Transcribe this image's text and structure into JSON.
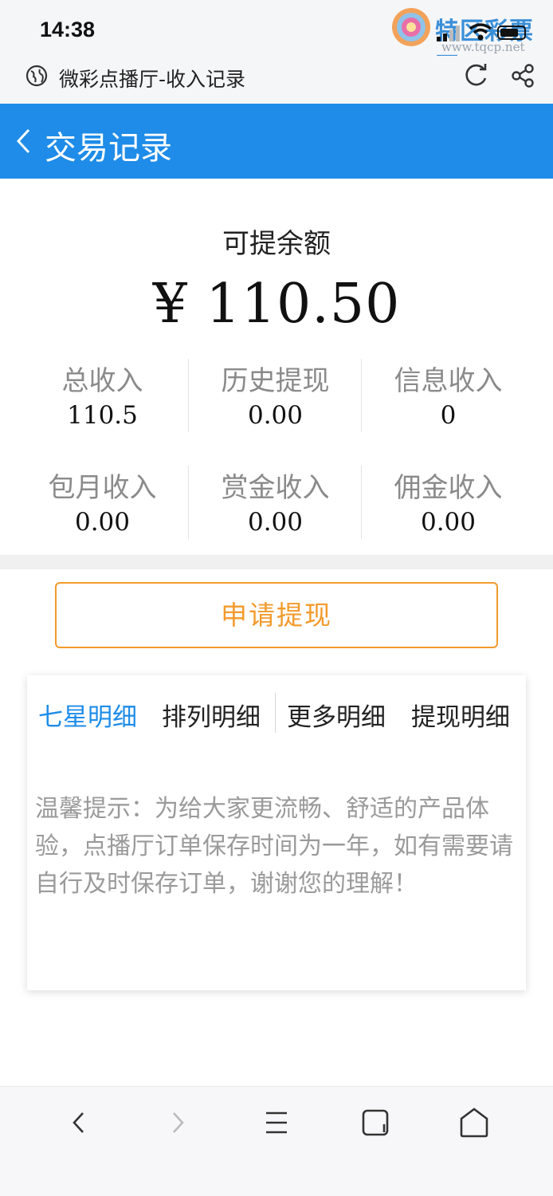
{
  "status_bar": {
    "time": "14:38",
    "watermark_text": "特区彩票网",
    "watermark_url": "www.tqcp.net",
    "signal_icon": "signal-icon",
    "wifi_icon": "wifi-icon",
    "battery_icon": "battery-icon"
  },
  "browser": {
    "page_title": "微彩点播厅-收入记录",
    "globe_icon": "globe-icon",
    "refresh_icon": "refresh-icon",
    "share_icon": "share-icon"
  },
  "header": {
    "title": "交易记录",
    "back_icon": "chevron-left-icon",
    "bg_color": "#1e8ce8"
  },
  "balance": {
    "label": "可提余额",
    "value": "¥ 110.50"
  },
  "stats": [
    {
      "label": "总收入",
      "value": "110.5"
    },
    {
      "label": "历史提现",
      "value": "0.00"
    },
    {
      "label": "信息收入",
      "value": "0"
    },
    {
      "label": "包月收入",
      "value": "0.00"
    },
    {
      "label": "赏金收入",
      "value": "0.00"
    },
    {
      "label": "佣金收入",
      "value": "0.00"
    }
  ],
  "withdraw_button": {
    "label": "申请提现",
    "color": "#f39a2b"
  },
  "tabs": [
    {
      "label": "七星明细",
      "active": true
    },
    {
      "label": "排列明细",
      "active": false
    },
    {
      "label": "更多明细",
      "active": false
    },
    {
      "label": "提现明细",
      "active": false
    }
  ],
  "notice": "温馨提示：为给大家更流畅、舒适的产品体验，点播厅订单保存时间为一年，如有需要请自行及时保存订单，谢谢您的理解！",
  "bottom_nav": [
    "nav-back-icon",
    "nav-forward-icon",
    "menu-icon",
    "tabs-icon",
    "home-icon"
  ]
}
